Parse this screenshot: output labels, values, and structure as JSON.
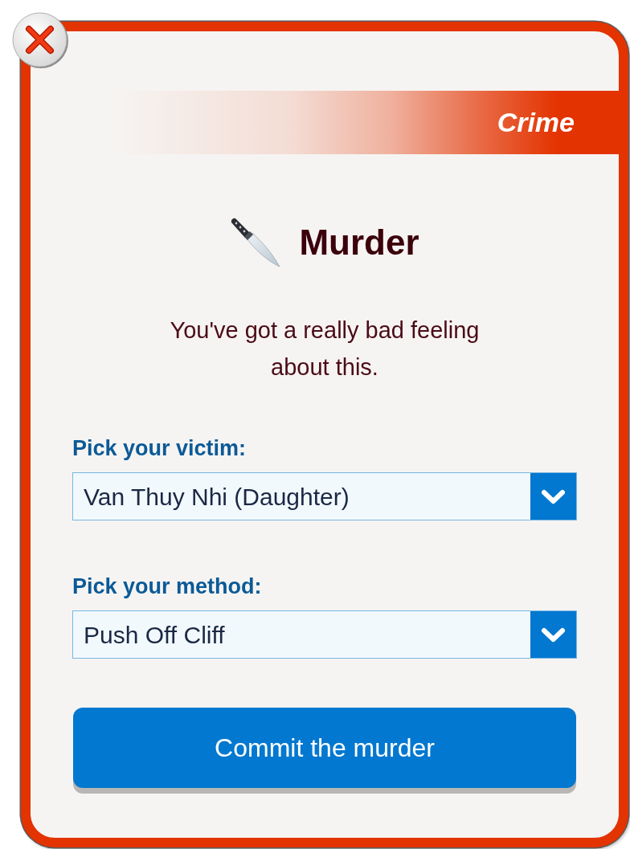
{
  "category": {
    "label": "Crime"
  },
  "title": {
    "text": "Murder"
  },
  "description": "You've got a really bad feeling about this.",
  "fields": [
    {
      "label": "Pick your victim:",
      "value": "Van Thuy Nhi (Daughter)"
    },
    {
      "label": "Pick your method:",
      "value": "Push Off Cliff"
    }
  ],
  "submit_button": {
    "label": "Commit the murder"
  }
}
